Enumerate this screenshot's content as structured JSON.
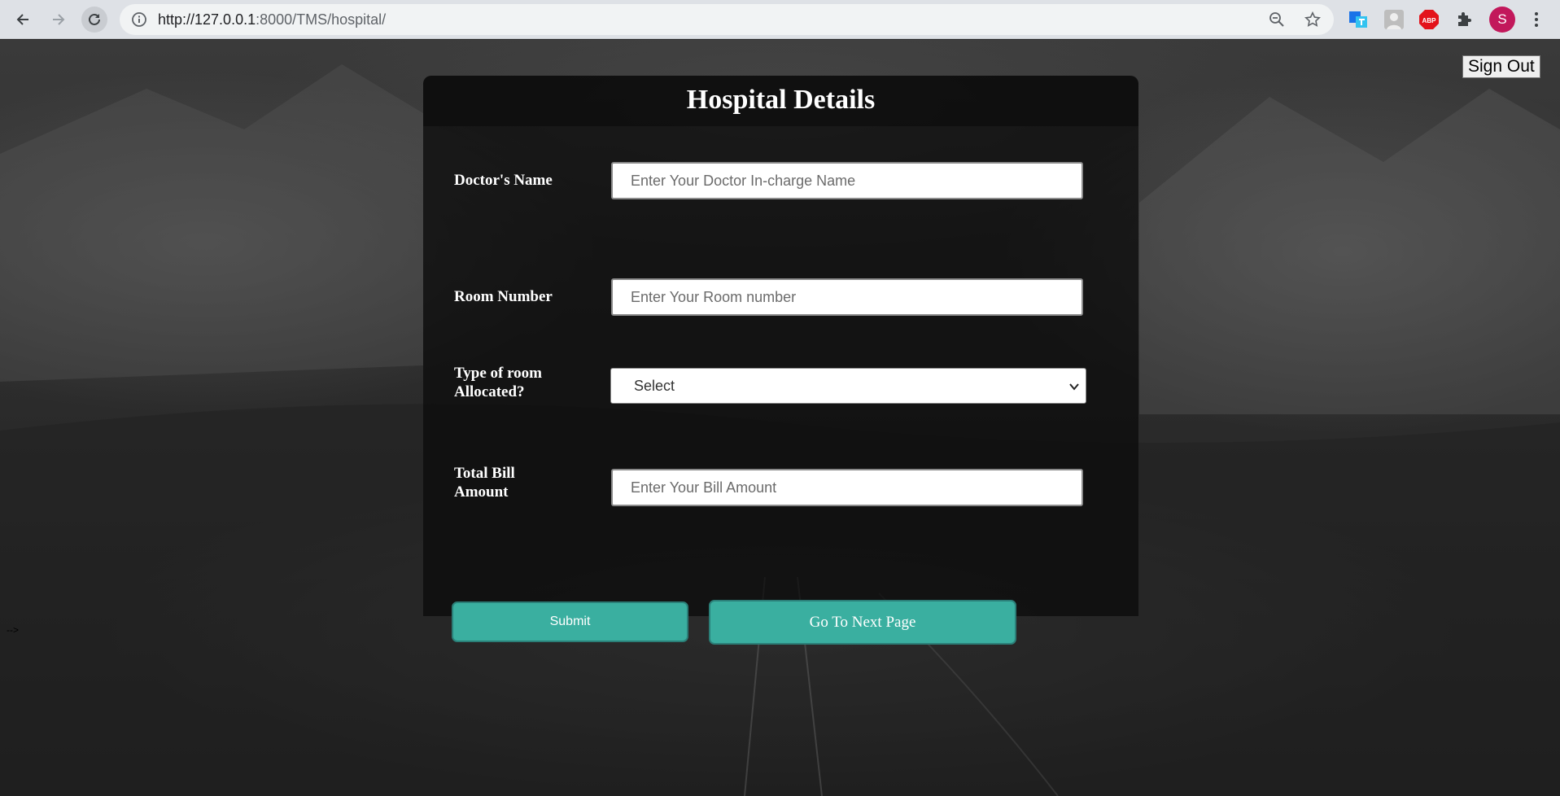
{
  "browser": {
    "url_host": "http://127.0.0.1",
    "url_path": ":8000/TMS/hospital/",
    "profile_initial": "S",
    "icons": [
      "back-icon",
      "forward-icon",
      "reload-icon",
      "info-icon",
      "zoom-icon",
      "star-icon",
      "translate-extension-icon",
      "profile-image-extension-icon",
      "adblock-plus-icon",
      "extensions-puzzle-icon",
      "kebab-menu-icon"
    ],
    "abp_label": "ABP"
  },
  "header": {
    "signout_label": "Sign Out"
  },
  "form": {
    "title": "Hospital Details",
    "doctor": {
      "label": "Doctor's Name",
      "placeholder": "Enter Your Doctor In-charge Name",
      "value": ""
    },
    "room": {
      "label": "Room Number",
      "placeholder": "Enter Your Room number",
      "value": ""
    },
    "room_type": {
      "label": "Type of room Allocated?",
      "selected": "Select"
    },
    "bill": {
      "label": "Total Bill Amount",
      "placeholder": "Enter Your Bill Amount",
      "value": ""
    },
    "submit_label": "Submit",
    "next_label": "Go To Next Page"
  },
  "stray_text": "-->",
  "colors": {
    "button": "#3aafa0",
    "avatar": "#c2185b",
    "abp": "#e3131b"
  }
}
